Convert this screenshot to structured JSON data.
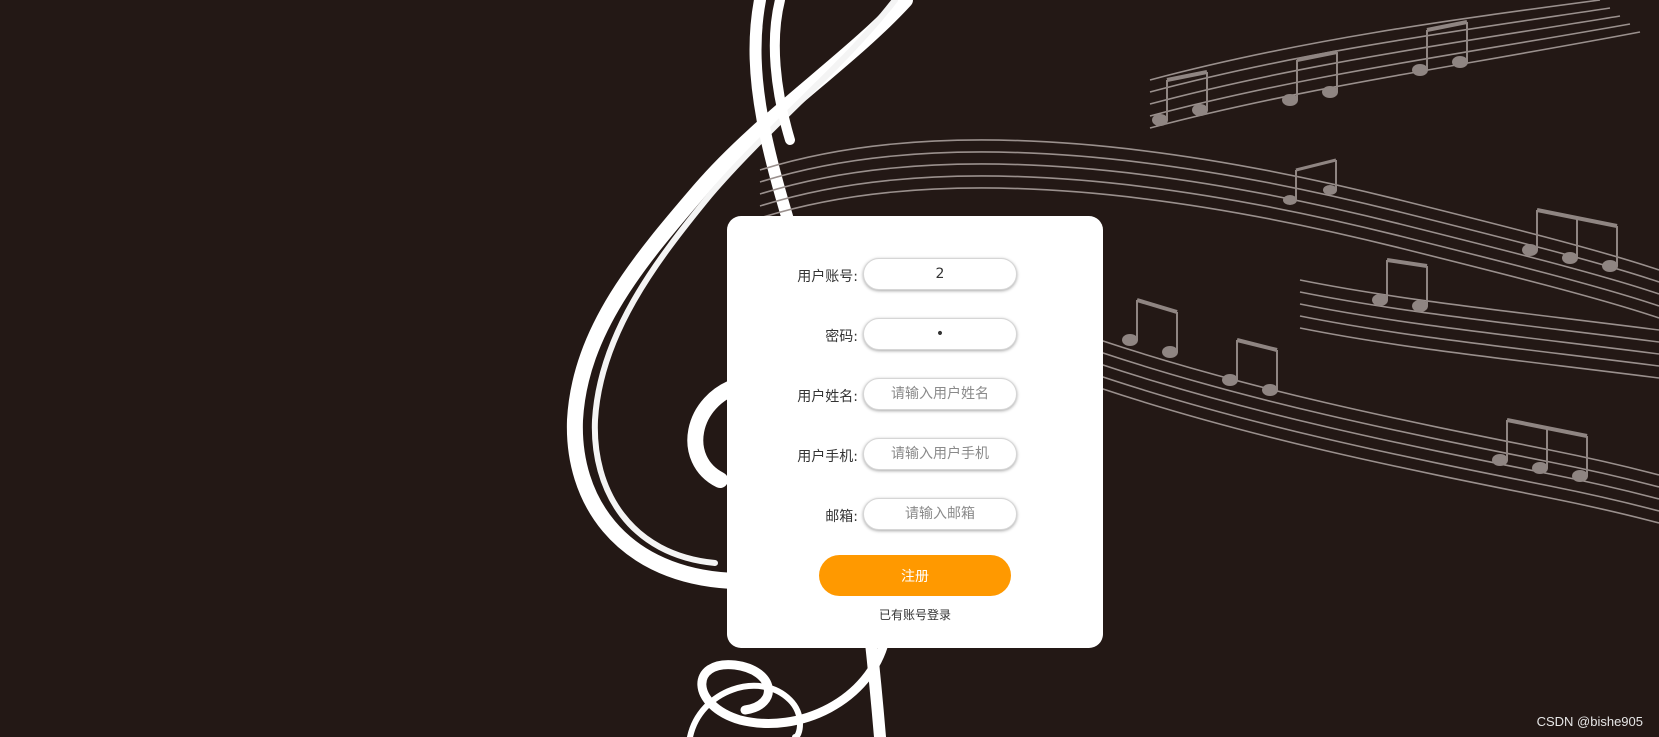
{
  "form": {
    "fields": [
      {
        "label": "用户账号:",
        "value": "2",
        "placeholder": ""
      },
      {
        "label": "密码:",
        "value": "•",
        "placeholder": ""
      },
      {
        "label": "用户姓名:",
        "value": "",
        "placeholder": "请输入用户姓名"
      },
      {
        "label": "用户手机:",
        "value": "",
        "placeholder": "请输入用户手机"
      },
      {
        "label": "邮箱:",
        "value": "",
        "placeholder": "请输入邮箱"
      }
    ],
    "submit_label": "注册",
    "login_link": "已有账号登录"
  },
  "watermark": "CSDN @bishe905",
  "colors": {
    "background": "#231815",
    "card": "#ffffff",
    "accent": "#ff9900",
    "notes": "#8f8582"
  }
}
